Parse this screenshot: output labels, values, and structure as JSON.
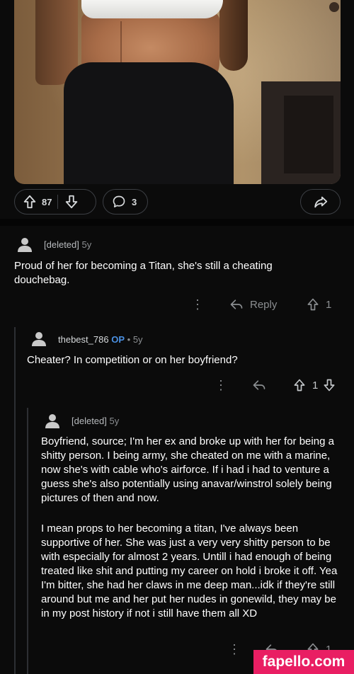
{
  "post": {
    "upvotes": "87",
    "comments": "3"
  },
  "comments": [
    {
      "author": "[deleted]",
      "age": "5y",
      "body": "Proud of her for becoming a Titan, she's still a cheating douchebag.",
      "reply_label": "Reply",
      "score": "1"
    },
    {
      "author": "thebest_786",
      "badge": "OP",
      "separator": "•",
      "age": "5y",
      "body": "Cheater? In competition or on her boyfriend?",
      "score": "1"
    },
    {
      "author": "[deleted]",
      "age": "5y",
      "paragraphs": [
        "Boyfriend, source; I'm her ex and broke up with her for being a shitty person. I being army, she cheated on me with a marine, now she's with cable who's airforce. If i had i had to venture a guess she's also potentially using anavar/winstrol solely being pictures of then and now.",
        "I mean props to her becoming a titan,  I've always been supportive of her. She was just a very very shitty person to be with especially for almost 2 years. Untill i had enough of being treated like shit and putting my career on hold i broke it off. Yea I'm bitter, she had her claws in me deep man...idk if they're still around but me and her put her nudes in gonewild, they may be in my post history if not i still have them all XD"
      ],
      "score": "1"
    }
  ],
  "watermark": "fapello.com",
  "colors": {
    "op_badge": "#4a90e2",
    "watermark_bg": "#e91e63"
  },
  "icons": [
    "upvote-icon",
    "downvote-icon",
    "comment-bubble-icon",
    "share-icon",
    "more-options-icon",
    "reply-icon",
    "avatar-icon"
  ]
}
